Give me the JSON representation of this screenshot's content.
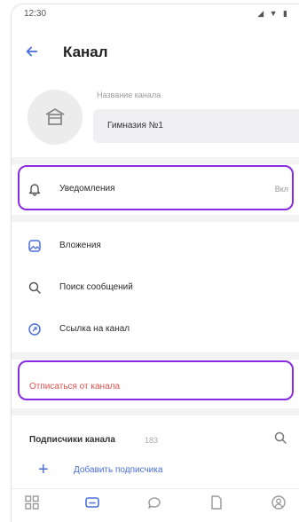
{
  "status_bar": {
    "time": "12:30",
    "icons": "◢ ▼ ▮"
  },
  "header": {
    "title": "Канал"
  },
  "channel": {
    "name_label": "Название канала",
    "name_value": "Гимназия №1"
  },
  "menu": {
    "notifications": {
      "label": "Уведомления",
      "value": "Вкл"
    },
    "attachments": {
      "label": "Вложения"
    },
    "search_messages": {
      "label": "Поиск сообщений"
    },
    "channel_link": {
      "label": "Ссылка на канал"
    },
    "leave": {
      "label": "Отписаться от канала"
    }
  },
  "subscribers": {
    "title": "Подписчики канала",
    "count": "183",
    "add_label": "Добавить подписчика"
  },
  "colors": {
    "accent": "#4a6fd9",
    "danger": "#e05050",
    "highlight": "#8a2be2"
  }
}
